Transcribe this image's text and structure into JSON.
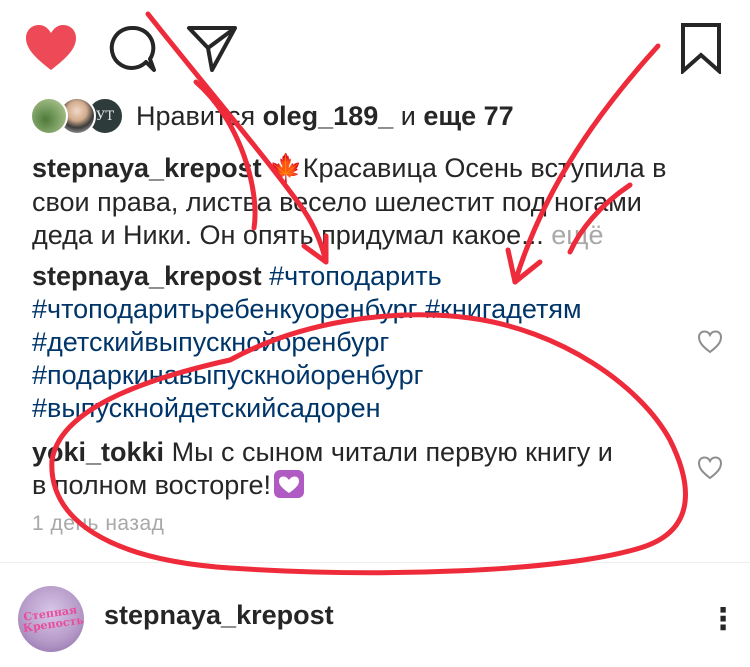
{
  "actions": {
    "like_icon": "heart-icon-filled",
    "comment_icon": "comment-icon",
    "share_icon": "send-icon",
    "save_icon": "bookmark-icon",
    "like_color": "#ed4956"
  },
  "likes": {
    "prefix": "Нравится ",
    "user": "oleg_189_",
    "joiner": " и ",
    "others": "еще 77",
    "avatar_badge": "УТ"
  },
  "caption": {
    "user": "stepnaya_krepost",
    "emoji": "🍁",
    "line1": "Красавица Осень вступила в",
    "line2": "свои права, листва весело шелестит под ногами",
    "line3": "деда и Ники. Он опять придумал какое...",
    "more": "ещё"
  },
  "comments": [
    {
      "user": "stepnaya_krepost",
      "tags": [
        "#чтоподарить",
        "#чтоподаритьребенкуоренбург #книгадетям",
        "#детскийвыпускнойоренбург",
        "#подаркинавыпускнойоренбург",
        "#выпускнойдетскийсадорен"
      ]
    },
    {
      "user": "yoki_tokki",
      "line1": "Мы с сыном читали первую книгу и",
      "line2": "в полном восторге!",
      "emoji": "💟"
    }
  ],
  "timestamp": "1 день назад",
  "next_post": {
    "user": "stepnaya_krepost",
    "avatar_text": "Степная Крепость",
    "more_icon": "more-dots-icon",
    "more_label": "⋮"
  },
  "annotation_color": "#ee2b3b"
}
